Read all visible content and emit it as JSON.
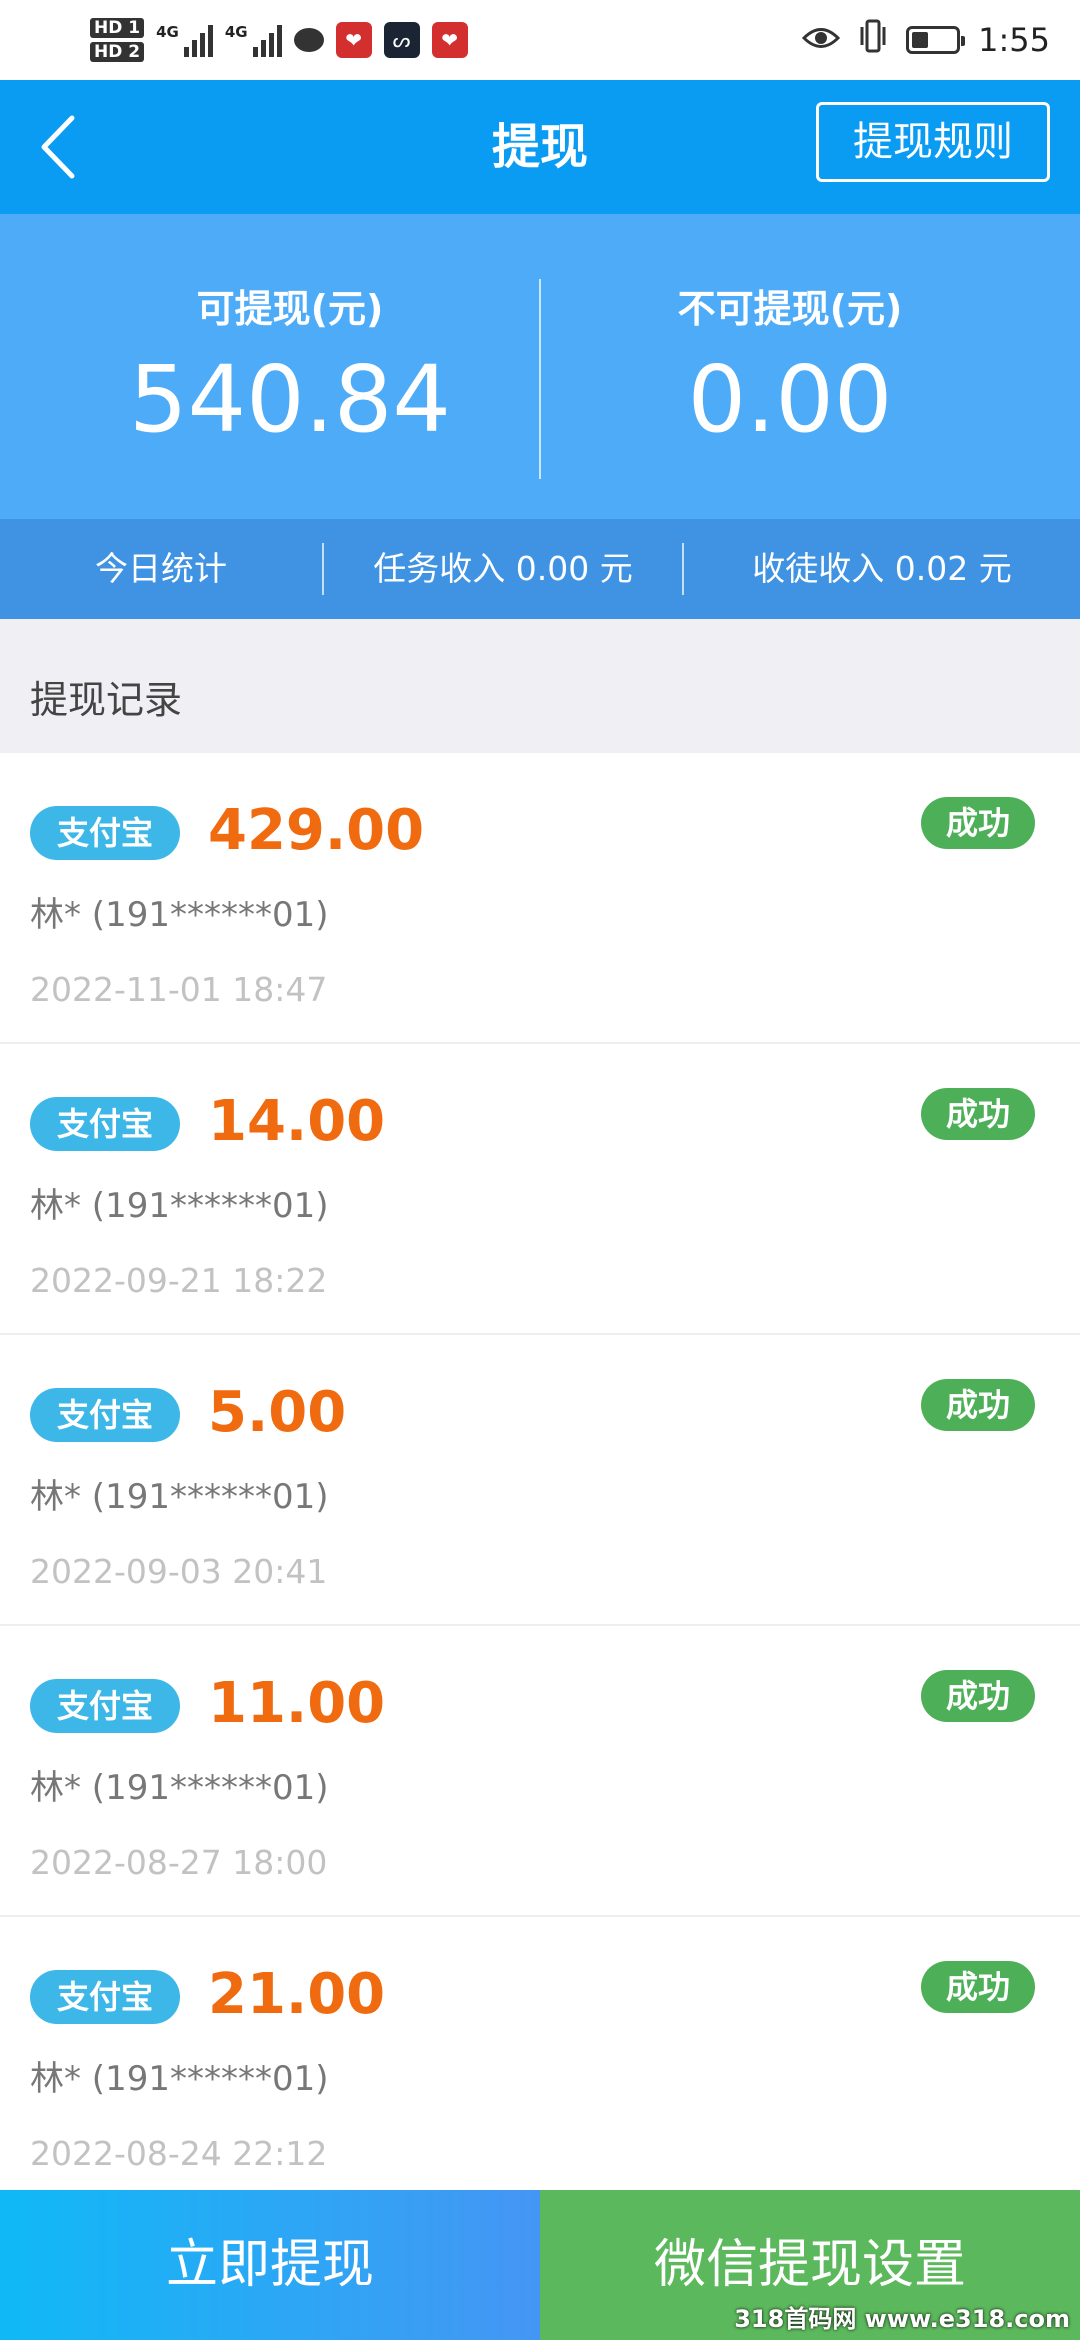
{
  "status_bar": {
    "hd1": "HD 1",
    "hd2": "HD 2",
    "net1": "4G",
    "net2": "4G",
    "time": "1:55"
  },
  "header": {
    "title": "提现",
    "rules_label": "提现规则"
  },
  "balance": {
    "available_label": "可提现(元)",
    "available_value": "540.84",
    "unavailable_label": "不可提现(元)",
    "unavailable_value": "0.00"
  },
  "stats": {
    "today": "今日统计",
    "task_income": "任务收入 0.00 元",
    "apprentice_income": "收徒收入 0.02 元"
  },
  "records_title": "提现记录",
  "records": [
    {
      "method": "支付宝",
      "amount": "429.00",
      "status": "成功",
      "account": "林* (191******01)",
      "time": "2022-11-01 18:47"
    },
    {
      "method": "支付宝",
      "amount": "14.00",
      "status": "成功",
      "account": "林* (191******01)",
      "time": "2022-09-21 18:22"
    },
    {
      "method": "支付宝",
      "amount": "5.00",
      "status": "成功",
      "account": "林* (191******01)",
      "time": "2022-09-03 20:41"
    },
    {
      "method": "支付宝",
      "amount": "11.00",
      "status": "成功",
      "account": "林* (191******01)",
      "time": "2022-08-27 18:00"
    },
    {
      "method": "支付宝",
      "amount": "21.00",
      "status": "成功",
      "account": "林* (191******01)",
      "time": "2022-08-24 22:12"
    }
  ],
  "bottom": {
    "withdraw_label": "立即提现",
    "wechat_label": "微信提现设置"
  },
  "watermark": "318首码网 www.e318.com",
  "colors": {
    "header_blue": "#0a9bf2",
    "amount_orange": "#f06a0f",
    "success_green": "#4db058"
  }
}
